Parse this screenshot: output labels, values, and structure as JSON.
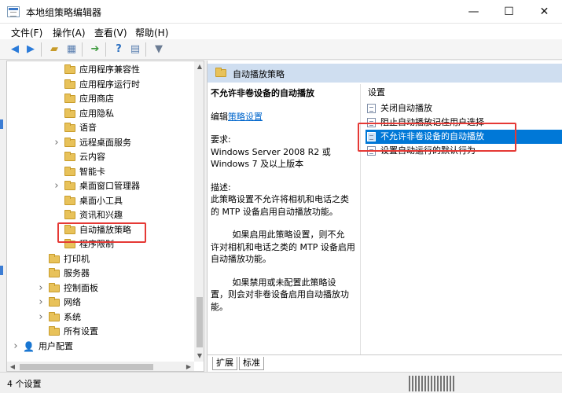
{
  "window": {
    "title": "本地组策略编辑器",
    "minimize_glyph": "—",
    "maximize_glyph": "☐",
    "close_glyph": "✕"
  },
  "menu": [
    {
      "label": "文件(F)"
    },
    {
      "label": "操作(A)"
    },
    {
      "label": "查看(V)"
    },
    {
      "label": "帮助(H)"
    }
  ],
  "toolbar": {
    "icons": [
      "back-arrow-icon",
      "forward-arrow-icon",
      "up-folder-icon",
      "show-hide-tree-icon",
      "export-list-icon",
      "help-icon",
      "properties-icon",
      "filter-icon"
    ]
  },
  "tree": [
    {
      "label": "应用程序兼容性",
      "level": 2,
      "expandable": false,
      "selected": false
    },
    {
      "label": "应用程序运行时",
      "level": 2,
      "expandable": false,
      "selected": false
    },
    {
      "label": "应用商店",
      "level": 2,
      "expandable": false,
      "selected": false
    },
    {
      "label": "应用隐私",
      "level": 2,
      "expandable": false,
      "selected": false
    },
    {
      "label": "语音",
      "level": 2,
      "expandable": false,
      "selected": false
    },
    {
      "label": "远程桌面服务",
      "level": 2,
      "expandable": true,
      "selected": false
    },
    {
      "label": "云内容",
      "level": 2,
      "expandable": false,
      "selected": false
    },
    {
      "label": "智能卡",
      "level": 2,
      "expandable": false,
      "selected": false
    },
    {
      "label": "桌面窗口管理器",
      "level": 2,
      "expandable": true,
      "selected": false
    },
    {
      "label": "桌面小工具",
      "level": 2,
      "expandable": false,
      "selected": false
    },
    {
      "label": "资讯和兴趣",
      "level": 2,
      "expandable": false,
      "selected": false
    },
    {
      "label": "自动播放策略",
      "level": 2,
      "expandable": false,
      "selected": true
    },
    {
      "label": "程序限制",
      "level": 2,
      "expandable": false,
      "selected": false
    },
    {
      "label": "打印机",
      "level": 1,
      "expandable": false,
      "selected": false
    },
    {
      "label": "服务器",
      "level": 1,
      "expandable": false,
      "selected": false
    },
    {
      "label": "控制面板",
      "level": 1,
      "expandable": true,
      "selected": false
    },
    {
      "label": "网络",
      "level": 1,
      "expandable": true,
      "selected": false
    },
    {
      "label": "系统",
      "level": 1,
      "expandable": true,
      "selected": false
    },
    {
      "label": "所有设置",
      "level": 1,
      "expandable": false,
      "selected": false
    },
    {
      "label": "用户配置",
      "level": 0,
      "expandable": true,
      "selected": false
    }
  ],
  "right_header": "自动播放策略",
  "description": {
    "title": "不允许非卷设备的自动播放",
    "edit_prefix": "编辑",
    "edit_link": "策略设置",
    "requirements_label": "要求:",
    "requirements_text_1": "Windows Server 2008 R2 或",
    "requirements_text_2": "Windows 7 及以上版本",
    "desc_label": "描述:",
    "desc_1": "此策略设置不允许将相机和电话之类",
    "desc_2": "的 MTP 设备启用自动播放功能。",
    "desc_3": "如果启用此策略设置，则不允",
    "desc_4": "许对相机和电话之类的 MTP 设备启用",
    "desc_5": "自动播放功能。",
    "desc_6": "如果禁用或未配置此策略设",
    "desc_7": "置，则会对非卷设备启用自动播放功",
    "desc_8": "能。"
  },
  "settings_list": {
    "header": "设置",
    "items": [
      {
        "label": "关闭自动播放",
        "selected": false
      },
      {
        "label": "阻止自动播放记住用户选择",
        "selected": false
      },
      {
        "label": "不允许非卷设备的自动播放",
        "selected": true
      },
      {
        "label": "设置自动运行的默认行为",
        "selected": false
      }
    ]
  },
  "tabs": [
    {
      "label": "扩展"
    },
    {
      "label": "标准"
    }
  ],
  "status": "4 个设置",
  "colors": {
    "selection": "#0078d7",
    "header_band": "#cfdef0",
    "annotation_red": "#e53935"
  }
}
